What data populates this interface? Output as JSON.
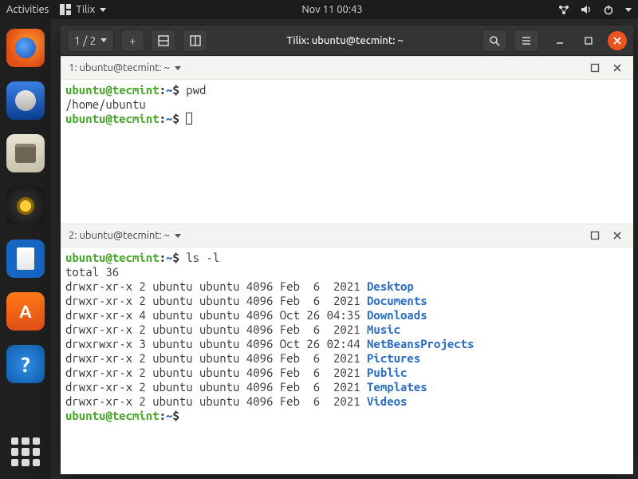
{
  "topbar": {
    "activities": "Activities",
    "app_name": "Tilix",
    "clock": "Nov 11  00:43"
  },
  "dock": {
    "items": [
      "firefox",
      "thunderbird",
      "files",
      "rhythmbox",
      "libreoffice-writer",
      "ubuntu-software",
      "help"
    ]
  },
  "window": {
    "title": "Tilix: ubuntu@tecmint: ~",
    "session_switch": "1 / 2"
  },
  "pane1": {
    "title": "1: ubuntu@tecmint: ~",
    "prompt_user": "ubuntu@tecmint",
    "prompt_path": "~",
    "cmd1": "pwd",
    "out1": "/home/ubuntu"
  },
  "pane2": {
    "title": "2: ubuntu@tecmint: ~",
    "prompt_user": "ubuntu@tecmint",
    "prompt_path": "~",
    "cmd1": "ls -l",
    "total_line": "total 36",
    "rows": [
      {
        "perm": "drwxr-xr-x",
        "n": "2",
        "u": "ubuntu",
        "g": "ubuntu",
        "sz": "4096",
        "date": "Feb  6  2021",
        "name": "Desktop"
      },
      {
        "perm": "drwxr-xr-x",
        "n": "2",
        "u": "ubuntu",
        "g": "ubuntu",
        "sz": "4096",
        "date": "Feb  6  2021",
        "name": "Documents"
      },
      {
        "perm": "drwxr-xr-x",
        "n": "4",
        "u": "ubuntu",
        "g": "ubuntu",
        "sz": "4096",
        "date": "Oct 26 04:35",
        "name": "Downloads"
      },
      {
        "perm": "drwxr-xr-x",
        "n": "2",
        "u": "ubuntu",
        "g": "ubuntu",
        "sz": "4096",
        "date": "Feb  6  2021",
        "name": "Music"
      },
      {
        "perm": "drwxrwxr-x",
        "n": "3",
        "u": "ubuntu",
        "g": "ubuntu",
        "sz": "4096",
        "date": "Oct 26 02:44",
        "name": "NetBeansProjects"
      },
      {
        "perm": "drwxr-xr-x",
        "n": "2",
        "u": "ubuntu",
        "g": "ubuntu",
        "sz": "4096",
        "date": "Feb  6  2021",
        "name": "Pictures"
      },
      {
        "perm": "drwxr-xr-x",
        "n": "2",
        "u": "ubuntu",
        "g": "ubuntu",
        "sz": "4096",
        "date": "Feb  6  2021",
        "name": "Public"
      },
      {
        "perm": "drwxr-xr-x",
        "n": "2",
        "u": "ubuntu",
        "g": "ubuntu",
        "sz": "4096",
        "date": "Feb  6  2021",
        "name": "Templates"
      },
      {
        "perm": "drwxr-xr-x",
        "n": "2",
        "u": "ubuntu",
        "g": "ubuntu",
        "sz": "4096",
        "date": "Feb  6  2021",
        "name": "Videos"
      }
    ]
  }
}
